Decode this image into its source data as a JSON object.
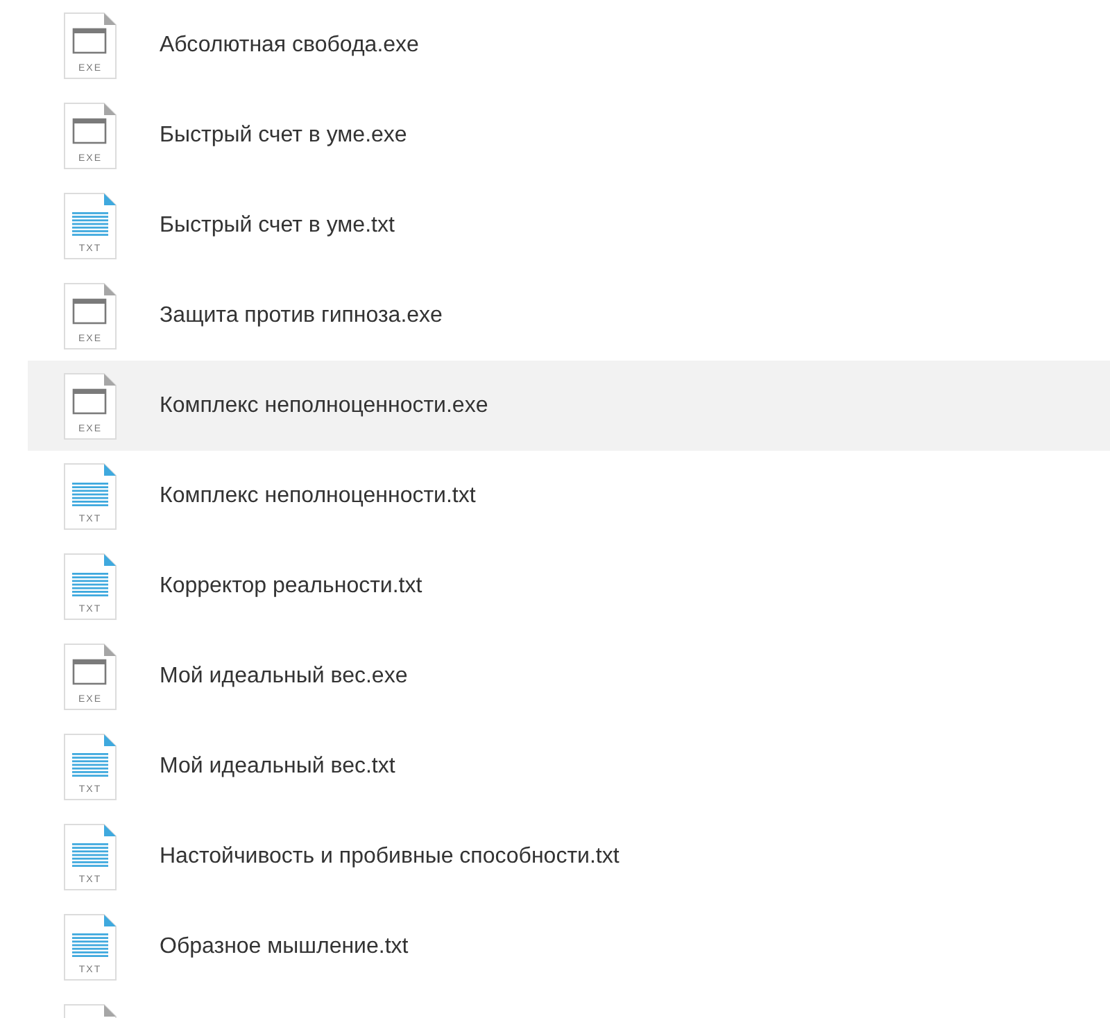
{
  "files": [
    {
      "kind": "exe",
      "ext_label": "EXE",
      "name": "Абсолютная свобода.exe",
      "selected": false
    },
    {
      "kind": "exe",
      "ext_label": "EXE",
      "name": "Быстрый счет в уме.exe",
      "selected": false
    },
    {
      "kind": "txt",
      "ext_label": "TXT",
      "name": "Быстрый счет в уме.txt",
      "selected": false
    },
    {
      "kind": "exe",
      "ext_label": "EXE",
      "name": "Защита против гипноза.exe",
      "selected": false
    },
    {
      "kind": "exe",
      "ext_label": "EXE",
      "name": "Комплекс неполноценности.exe",
      "selected": true
    },
    {
      "kind": "txt",
      "ext_label": "TXT",
      "name": "Комплекс неполноценности.txt",
      "selected": false
    },
    {
      "kind": "txt",
      "ext_label": "TXT",
      "name": "Корректор реальности.txt",
      "selected": false
    },
    {
      "kind": "exe",
      "ext_label": "EXE",
      "name": "Мой идеальный вес.exe",
      "selected": false
    },
    {
      "kind": "txt",
      "ext_label": "TXT",
      "name": "Мой идеальный вес.txt",
      "selected": false
    },
    {
      "kind": "txt",
      "ext_label": "TXT",
      "name": "Настойчивость и пробивные способности.txt",
      "selected": false
    },
    {
      "kind": "txt",
      "ext_label": "TXT",
      "name": "Образное мышление.txt",
      "selected": false
    },
    {
      "kind": "exe",
      "selected": false
    }
  ]
}
